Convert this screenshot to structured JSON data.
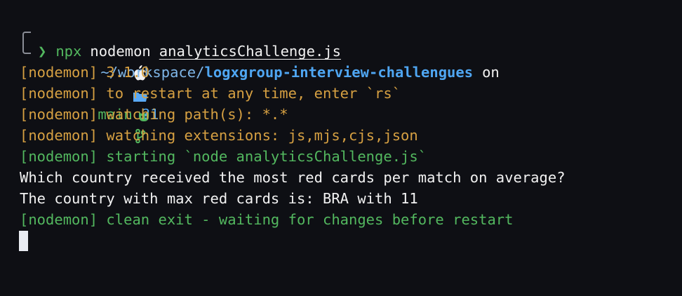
{
  "prompt": {
    "path_prefix": "~/workspace/",
    "repo_name": "logxgroup-interview-challengues",
    "on_text": "on",
    "branch": "main",
    "status": "?1",
    "prompt_symbol": "❯",
    "command": "npx",
    "command_args_1": "nodemon",
    "command_file": "analyticsChallenge.js"
  },
  "output": [
    {
      "text": "[nodemon] 3.1.0",
      "color": "yellow"
    },
    {
      "text": "[nodemon] to restart at any time, enter `rs`",
      "color": "yellow"
    },
    {
      "text": "[nodemon] watching path(s): *.*",
      "color": "yellow"
    },
    {
      "text": "[nodemon] watching extensions: js,mjs,cjs,json",
      "color": "yellow"
    },
    {
      "text": "[nodemon] starting `node analyticsChallenge.js`",
      "color": "green"
    },
    {
      "text": "Which country received the most red cards per match on average?",
      "color": "white"
    },
    {
      "text": "The country with max red cards is: BRA with 11",
      "color": "white"
    },
    {
      "text": "[nodemon] clean exit - waiting for changes before restart",
      "color": "green"
    }
  ],
  "colors": {
    "background": "#0e0f14",
    "yellow": "#d6a042",
    "green": "#53b85f",
    "blue": "#4fa6f2",
    "white": "#f2f2f2"
  },
  "icons": [
    "apple-icon",
    "folder-icon",
    "github-cat-icon",
    "git-branch-icon"
  ]
}
